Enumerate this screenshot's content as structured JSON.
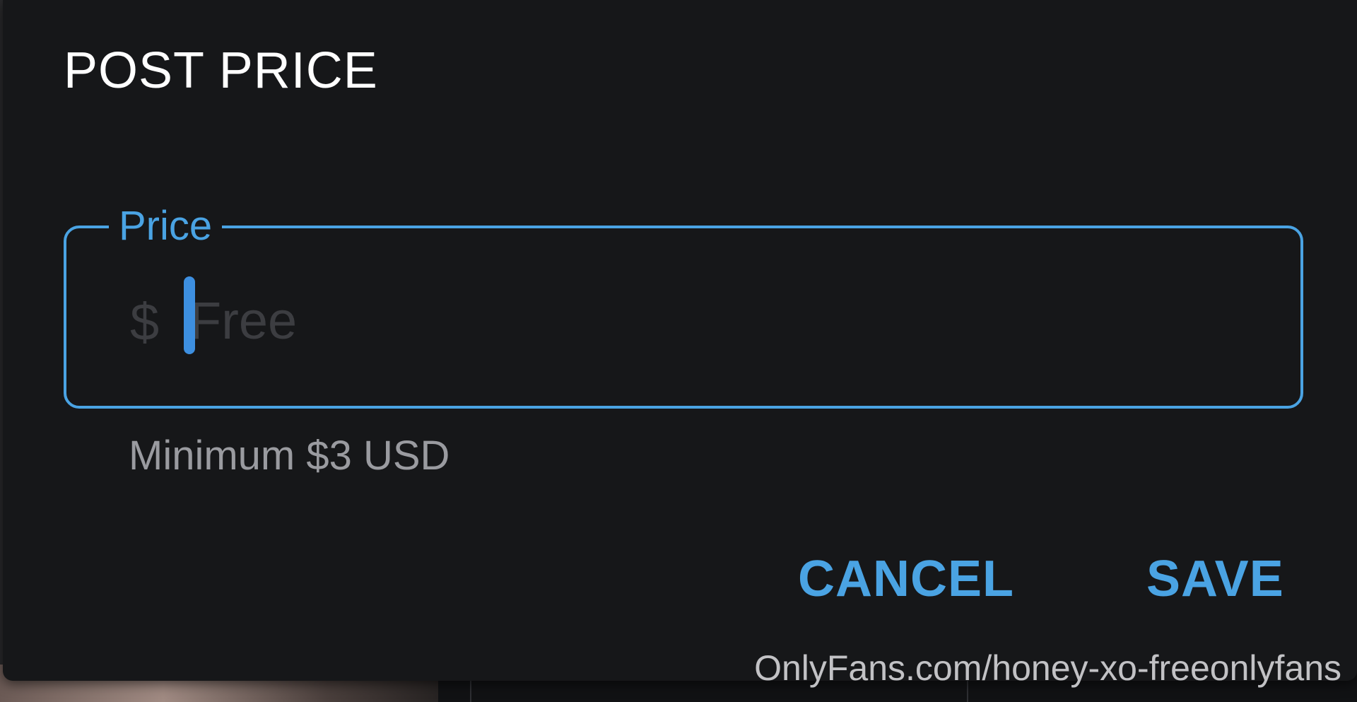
{
  "dialog": {
    "title": "POST PRICE",
    "price_field": {
      "label": "Price",
      "currency_symbol": "$",
      "value": "",
      "placeholder": "Free",
      "helper_text": "Minimum $3 USD"
    },
    "actions": {
      "cancel_label": "CANCEL",
      "save_label": "SAVE"
    }
  },
  "watermark": "OnlyFans.com/honey-xo-freeonlyfans",
  "colors": {
    "accent": "#4aa3e3",
    "caret": "#3d8fe0",
    "dialog_background": "#161719",
    "title_text": "#ffffff",
    "helper_text": "#9a9ba0",
    "placeholder_text": "#3c3d41"
  }
}
